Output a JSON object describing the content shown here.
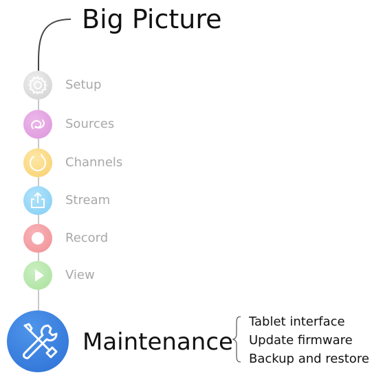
{
  "title": "Big Picture",
  "steps": [
    {
      "label": "Setup",
      "icon": "gear-icon"
    },
    {
      "label": "Sources",
      "icon": "link-icon"
    },
    {
      "label": "Channels",
      "icon": "circle-icon"
    },
    {
      "label": "Stream",
      "icon": "share-icon"
    },
    {
      "label": "Record",
      "icon": "record-icon"
    },
    {
      "label": "View",
      "icon": "play-icon"
    }
  ],
  "maintenance": {
    "label": "Maintenance",
    "icon": "tools-icon",
    "items": [
      "Tablet interface",
      "Update firmware",
      "Backup and restore"
    ]
  },
  "colors": {
    "setup": "#d9d9d9",
    "sources": "#e3a3e2",
    "channels": "#fad985",
    "stream": "#98d8f8",
    "record": "#f4a2a8",
    "view": "#b9e8ae",
    "maintenance": "#3a7ee0"
  }
}
